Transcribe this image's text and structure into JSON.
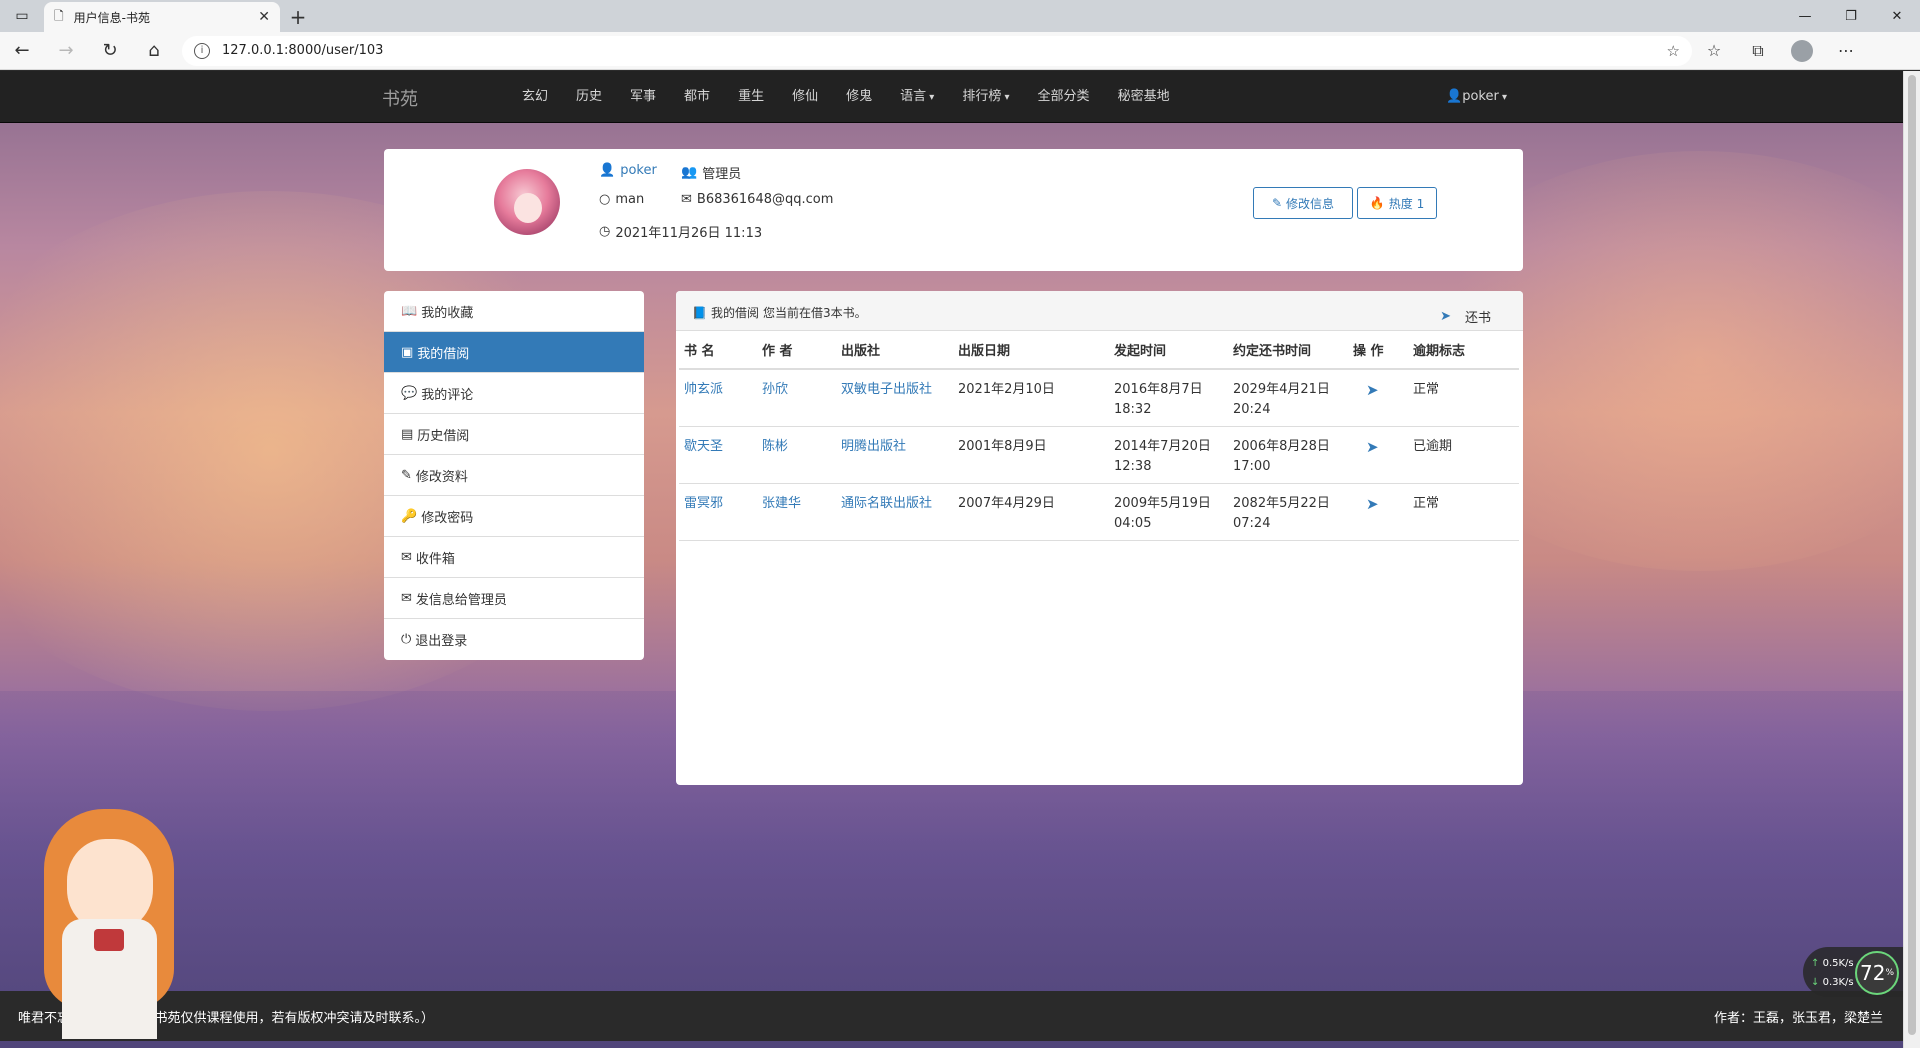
{
  "browser": {
    "tab_title": "用户信息-书苑",
    "url": "127.0.0.1:8000/user/103"
  },
  "site": {
    "brand": "书苑",
    "menu": [
      "玄幻",
      "历史",
      "军事",
      "都市",
      "重生",
      "修仙",
      "修鬼",
      "语言",
      "排行榜",
      "全部分类",
      "秘密基地"
    ],
    "user": "poker"
  },
  "profile": {
    "username": "poker",
    "role": "管理员",
    "gender": "man",
    "email": "B68361648@qq.com",
    "joined": "2021年11月26日 11:13",
    "edit_button": "修改信息",
    "heat_button": "热度 1"
  },
  "sidebar": {
    "items": [
      {
        "label": "我的收藏",
        "icon": "book-icon"
      },
      {
        "label": "我的借阅",
        "icon": "contact-card-icon"
      },
      {
        "label": "我的评论",
        "icon": "comment-icon"
      },
      {
        "label": "历史借阅",
        "icon": "history-book-icon"
      },
      {
        "label": "修改资料",
        "icon": "edit-icon"
      },
      {
        "label": "修改密码",
        "icon": "key-icon"
      },
      {
        "label": "收件箱",
        "icon": "envelope-icon"
      },
      {
        "label": "发信息给管理员",
        "icon": "envelope-icon"
      },
      {
        "label": "退出登录",
        "icon": "power-icon"
      }
    ],
    "active_index": 1
  },
  "borrow": {
    "header": "我的借阅",
    "subtitle": "您当前在借3本书。",
    "return_label": "还书",
    "columns": [
      "书 名",
      "作 者",
      "出版社",
      "出版日期",
      "发起时间",
      "约定还书时间",
      "操 作",
      "逾期标志"
    ],
    "rows": [
      {
        "title": "帅玄派",
        "author": "孙欣",
        "publisher": "双敏电子出版社",
        "pub_date": "2021年2月10日",
        "start_date": "2016年8月7日",
        "start_time": "18:32",
        "due_date": "2029年4月21日",
        "due_time": "20:24",
        "status": "正常"
      },
      {
        "title": "歇天圣",
        "author": "陈彬",
        "publisher": "明腾出版社",
        "pub_date": "2001年8月9日",
        "start_date": "2014年7月20日",
        "start_time": "12:38",
        "due_date": "2006年8月28日",
        "due_time": "17:00",
        "status": "已逾期"
      },
      {
        "title": "雷冥邪",
        "author": "张建华",
        "publisher": "通际名联出版社",
        "pub_date": "2007年4月29日",
        "start_date": "2009年5月19日",
        "start_time": "04:05",
        "due_date": "2082年5月22日",
        "due_time": "07:24",
        "status": "正常"
      }
    ]
  },
  "footer": {
    "left": "唯君不忘，天我不为。（书苑仅供课程使用，若有版权冲突请及时联系。）",
    "right": "作者：王磊，张玉君，梁楚兰"
  },
  "netwidget": {
    "up": "0.5K/s",
    "down": "0.3K/s",
    "percent": "72"
  },
  "colors": {
    "accent": "#337ab7",
    "navbar": "#222222"
  }
}
